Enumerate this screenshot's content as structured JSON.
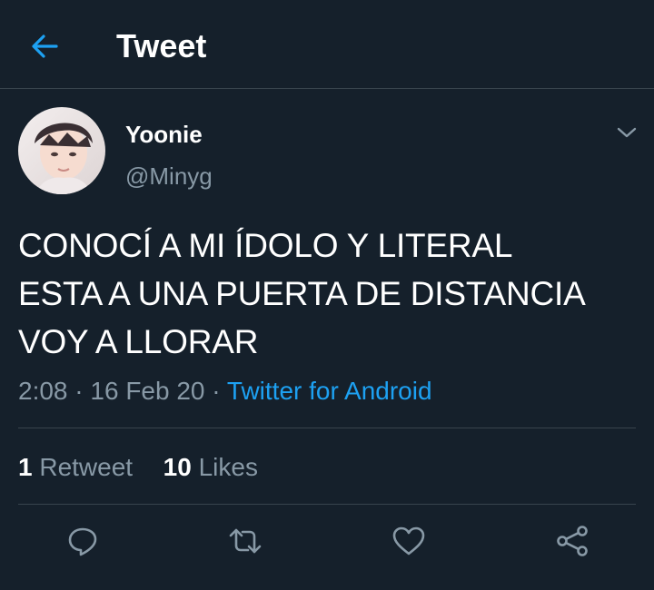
{
  "header": {
    "title": "Tweet",
    "back_icon": "arrow-left-icon",
    "accent_color": "#1da1f2"
  },
  "tweet": {
    "author": {
      "display_name": "Yoonie",
      "handle": "@Minyg"
    },
    "text_lines": [
      "CONOCÍ A MI ÍDOLO Y LITERAL",
      "ESTA A UNA PUERTA DE DISTANCIA",
      "VOY A LLORAR"
    ],
    "time": "2:08",
    "date": "16 Feb 20",
    "separator": "·",
    "source": "Twitter for Android",
    "stats": {
      "retweets_count": "1",
      "retweets_label": "Retweet",
      "likes_count": "10",
      "likes_label": "Likes"
    }
  },
  "actions": [
    "reply-icon",
    "retweet-icon",
    "like-icon",
    "share-icon"
  ],
  "colors": {
    "background": "#15202b",
    "divider": "#38444d",
    "secondary_text": "#8899a6",
    "link": "#1da1f2"
  }
}
